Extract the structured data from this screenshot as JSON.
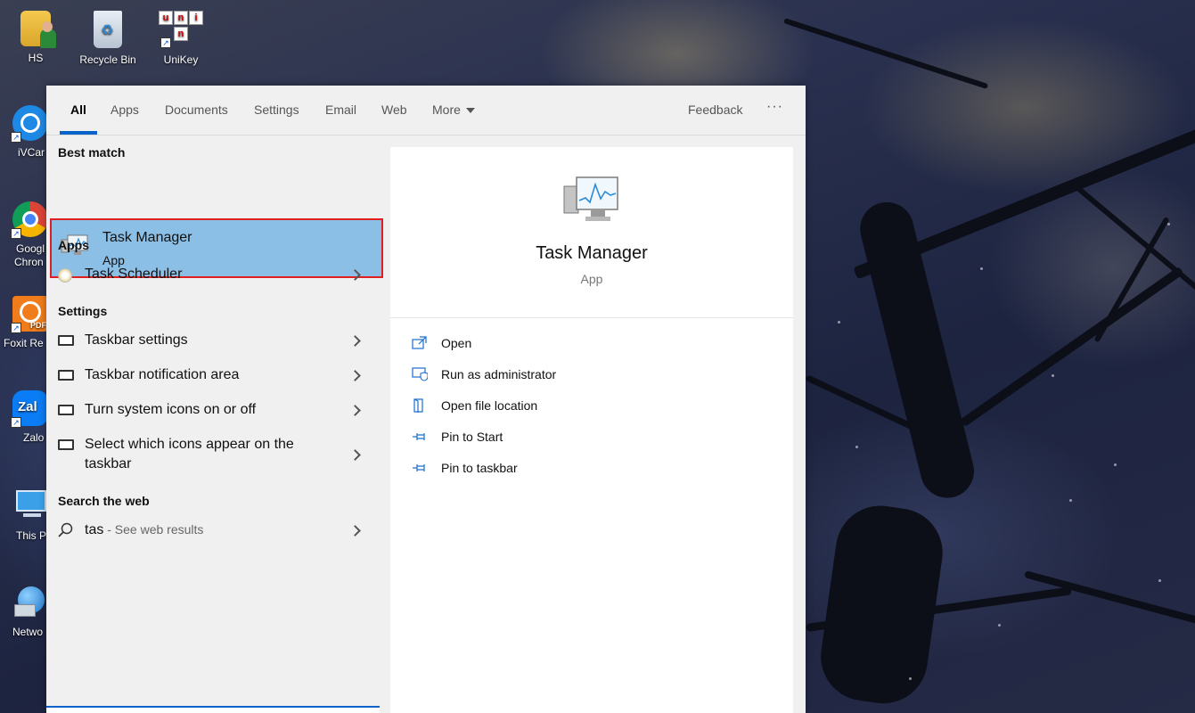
{
  "desktop": {
    "icons": [
      {
        "label": "HS",
        "icon": "user-folder-icon"
      },
      {
        "label": "Recycle Bin",
        "icon": "recycle-bin-icon"
      },
      {
        "label": "UniKey",
        "icon": "unikey-icon"
      },
      {
        "label": "iVCam",
        "icon": "ivcam-icon"
      },
      {
        "label": "Google Chrome",
        "icon": "chrome-icon"
      },
      {
        "label": "Foxit Reader",
        "icon": "foxit-icon"
      },
      {
        "label": "Zalo",
        "icon": "zalo-icon"
      },
      {
        "label": "This PC",
        "icon": "this-pc-icon"
      },
      {
        "label": "Network",
        "icon": "network-icon"
      }
    ],
    "visible_labels": {
      "ivcam": "iVCar",
      "chrome_line1": "Googl",
      "chrome_line2": "Chron",
      "foxit": "Foxit Re",
      "zalo": "Zalo",
      "thispc": "This P",
      "network": "Netwo"
    }
  },
  "search": {
    "tabs": [
      {
        "label": "All",
        "active": true
      },
      {
        "label": "Apps"
      },
      {
        "label": "Documents"
      },
      {
        "label": "Settings"
      },
      {
        "label": "Email"
      },
      {
        "label": "Web"
      },
      {
        "label": "More"
      }
    ],
    "feedback_label": "Feedback",
    "more_options_label": "···",
    "best_match": {
      "header": "Best match",
      "name": "Task Manager",
      "type": "App"
    },
    "apps": {
      "header": "Apps",
      "items": [
        {
          "label": "Task Scheduler"
        }
      ]
    },
    "settings": {
      "header": "Settings",
      "items": [
        {
          "label": "Taskbar settings"
        },
        {
          "label": "Taskbar notification area"
        },
        {
          "label": "Turn system icons on or off"
        },
        {
          "label_line1": "Select which icons appear on the",
          "label_line2": "taskbar"
        }
      ]
    },
    "web": {
      "header": "Search the web",
      "query": "tas",
      "suffix": " - See web results"
    },
    "preview": {
      "name": "Task Manager",
      "type": "App",
      "actions": [
        {
          "label": "Open",
          "icon": "open-icon"
        },
        {
          "label": "Run as administrator",
          "icon": "shield-icon"
        },
        {
          "label": "Open file location",
          "icon": "file-location-icon"
        },
        {
          "label": "Pin to Start",
          "icon": "pin-icon"
        },
        {
          "label": "Pin to taskbar",
          "icon": "pin-icon"
        }
      ]
    }
  },
  "colors": {
    "accent": "#0a63c9",
    "selection": "#8cbfe6",
    "highlight_border": "#e02020"
  }
}
